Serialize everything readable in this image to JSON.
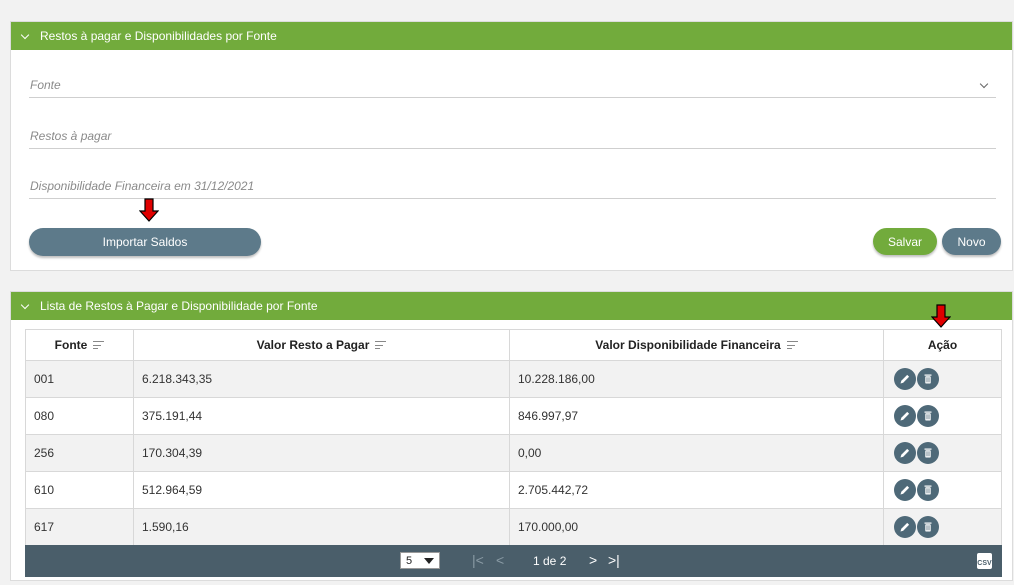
{
  "panel1": {
    "title": "Restos à pagar e Disponibilidades por Fonte",
    "fields": {
      "fonte_placeholder": "Fonte",
      "restos_placeholder": "Restos à pagar",
      "disp_placeholder": "Disponibilidade Financeira em 31/12/2021"
    },
    "buttons": {
      "importar": "Importar Saldos",
      "salvar": "Salvar",
      "novo": "Novo"
    }
  },
  "panel2": {
    "title": "Lista de Restos à Pagar e Disponibilidade por Fonte",
    "columns": [
      "Fonte",
      "Valor Resto a Pagar",
      "Valor Disponibilidade Financeira",
      "Ação"
    ],
    "rows": [
      [
        "001",
        "6.218.343,35",
        "10.228.186,00"
      ],
      [
        "080",
        "375.191,44",
        "846.997,97"
      ],
      [
        "256",
        "170.304,39",
        "0,00"
      ],
      [
        "610",
        "512.964,59",
        "2.705.442,72"
      ],
      [
        "617",
        "1.590,16",
        "170.000,00"
      ]
    ],
    "pager": {
      "page_size": "5",
      "page_text": "1 de 2",
      "csv_label": "CSV"
    }
  },
  "colors": {
    "header_green": "#72ab3c",
    "slate": "#5d7a8a",
    "pager_bg": "#4a5e6a",
    "annotation_arrow": "#e00000"
  },
  "icons": [
    "chevron-down-icon",
    "sort-icon",
    "edit-icon",
    "delete-icon",
    "first-page-icon",
    "prev-page-icon",
    "next-page-icon",
    "last-page-icon",
    "csv-export-icon",
    "annotation-arrow-icon"
  ]
}
